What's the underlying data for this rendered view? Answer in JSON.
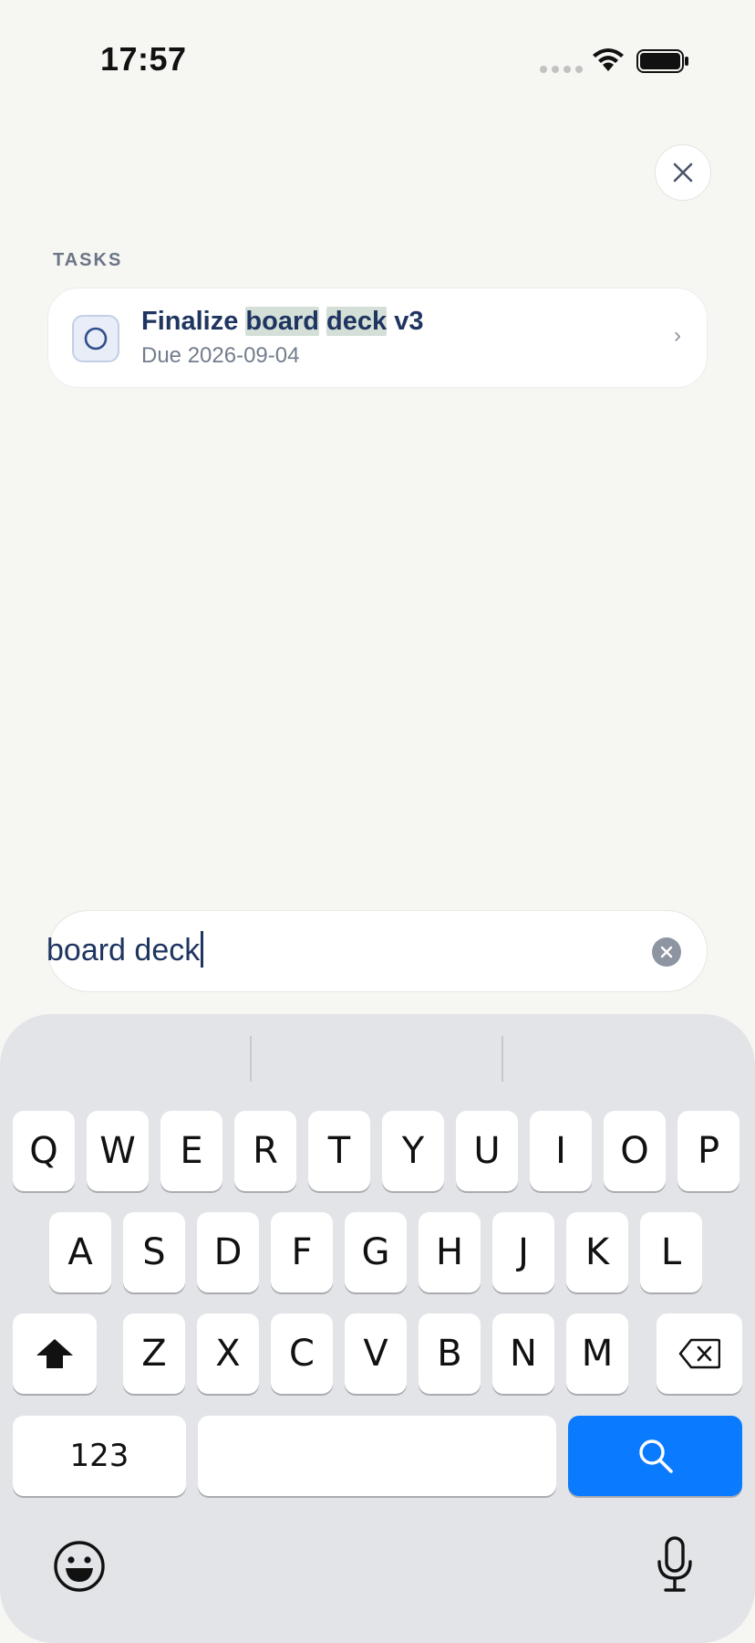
{
  "status_bar": {
    "time": "17:57"
  },
  "close_button": {
    "icon": "close-icon"
  },
  "section": {
    "title": "TASKS"
  },
  "results": [
    {
      "title_parts": [
        "Finalize ",
        "board",
        " ",
        "deck",
        " v3"
      ],
      "highlighted_parts": [
        1,
        3
      ],
      "due": "Due 2026-09-04"
    }
  ],
  "search": {
    "query": "board deck",
    "placeholder": ""
  },
  "keyboard": {
    "row1": [
      "Q",
      "W",
      "E",
      "R",
      "T",
      "Y",
      "U",
      "I",
      "O",
      "P"
    ],
    "row2": [
      "A",
      "S",
      "D",
      "F",
      "G",
      "H",
      "J",
      "K",
      "L"
    ],
    "row3": [
      "Z",
      "X",
      "C",
      "V",
      "B",
      "N",
      "M"
    ],
    "numbers_label": "123",
    "action_key": "search-icon"
  },
  "colors": {
    "accent": "#0a7aff",
    "highlight": "#d4dfd8",
    "title_text": "#1f3560"
  }
}
